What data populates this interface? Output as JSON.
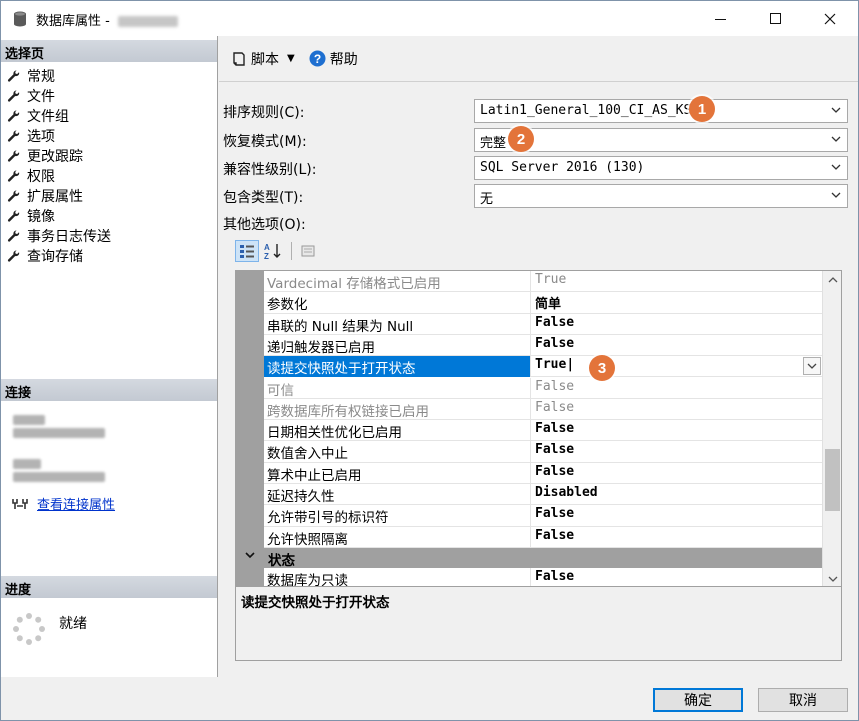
{
  "window": {
    "title": "数据库属性 - "
  },
  "left": {
    "select_page_header": "选择页",
    "pages": [
      "常规",
      "文件",
      "文件组",
      "选项",
      "更改跟踪",
      "权限",
      "扩展属性",
      "镜像",
      "事务日志传送",
      "查询存储"
    ],
    "connection_header": "连接",
    "view_connection_properties": "查看连接属性",
    "progress_header": "进度",
    "progress_status": "就绪"
  },
  "toolbar": {
    "script_label": "脚本",
    "help_label": "帮助"
  },
  "form": {
    "collation_label": "排序规则(C):",
    "collation_value": "Latin1_General_100_CI_AS_KS",
    "recovery_label": "恢复模式(M):",
    "recovery_value": "完整",
    "compat_label": "兼容性级别(L):",
    "compat_value": "SQL Server 2016 (130)",
    "containment_label": "包含类型(T):",
    "containment_value": "无",
    "other_options_label": "其他选项(O):"
  },
  "badges": [
    "1",
    "2",
    "3"
  ],
  "grid": {
    "rows": [
      {
        "name": "Vardecimal 存储格式已启用",
        "value": "True"
      },
      {
        "name": "参数化",
        "value": "简单"
      },
      {
        "name": "串联的 Null 结果为 Null",
        "value": "False"
      },
      {
        "name": "递归触发器已启用",
        "value": "False"
      },
      {
        "name": "读提交快照处于打开状态",
        "value": "True"
      },
      {
        "name": "可信",
        "value": "False"
      },
      {
        "name": "跨数据库所有权链接已启用",
        "value": "False"
      },
      {
        "name": "日期相关性优化已启用",
        "value": "False"
      },
      {
        "name": "数值舍入中止",
        "value": "False"
      },
      {
        "name": "算术中止已启用",
        "value": "False"
      },
      {
        "name": "延迟持久性",
        "value": "Disabled"
      },
      {
        "name": "允许带引号的标识符",
        "value": "False"
      },
      {
        "name": "允许快照隔离",
        "value": "False"
      }
    ],
    "category": "状态",
    "last_row": {
      "name": "数据库为只读",
      "value": "False"
    }
  },
  "description": {
    "title": "读提交快照处于打开状态"
  },
  "buttons": {
    "ok": "确定",
    "cancel": "取消"
  },
  "colors": {
    "accent": "#0078d7",
    "badge": "#e3743a",
    "link": "#0033cc"
  }
}
